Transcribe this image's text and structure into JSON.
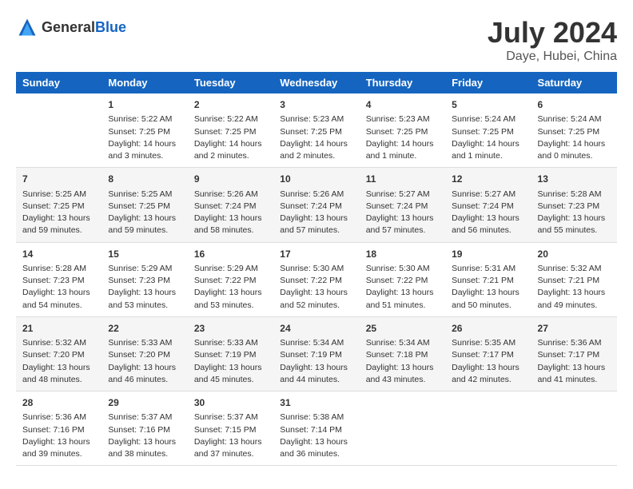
{
  "app": {
    "name_general": "General",
    "name_blue": "Blue"
  },
  "calendar": {
    "title": "July 2024",
    "location": "Daye, Hubei, China",
    "days_of_week": [
      "Sunday",
      "Monday",
      "Tuesday",
      "Wednesday",
      "Thursday",
      "Friday",
      "Saturday"
    ],
    "weeks": [
      [
        {
          "day": "",
          "details": ""
        },
        {
          "day": "1",
          "details": "Sunrise: 5:22 AM\nSunset: 7:25 PM\nDaylight: 14 hours\nand 3 minutes."
        },
        {
          "day": "2",
          "details": "Sunrise: 5:22 AM\nSunset: 7:25 PM\nDaylight: 14 hours\nand 2 minutes."
        },
        {
          "day": "3",
          "details": "Sunrise: 5:23 AM\nSunset: 7:25 PM\nDaylight: 14 hours\nand 2 minutes."
        },
        {
          "day": "4",
          "details": "Sunrise: 5:23 AM\nSunset: 7:25 PM\nDaylight: 14 hours\nand 1 minute."
        },
        {
          "day": "5",
          "details": "Sunrise: 5:24 AM\nSunset: 7:25 PM\nDaylight: 14 hours\nand 1 minute."
        },
        {
          "day": "6",
          "details": "Sunrise: 5:24 AM\nSunset: 7:25 PM\nDaylight: 14 hours\nand 0 minutes."
        }
      ],
      [
        {
          "day": "7",
          "details": "Sunrise: 5:25 AM\nSunset: 7:25 PM\nDaylight: 13 hours\nand 59 minutes."
        },
        {
          "day": "8",
          "details": "Sunrise: 5:25 AM\nSunset: 7:25 PM\nDaylight: 13 hours\nand 59 minutes."
        },
        {
          "day": "9",
          "details": "Sunrise: 5:26 AM\nSunset: 7:24 PM\nDaylight: 13 hours\nand 58 minutes."
        },
        {
          "day": "10",
          "details": "Sunrise: 5:26 AM\nSunset: 7:24 PM\nDaylight: 13 hours\nand 57 minutes."
        },
        {
          "day": "11",
          "details": "Sunrise: 5:27 AM\nSunset: 7:24 PM\nDaylight: 13 hours\nand 57 minutes."
        },
        {
          "day": "12",
          "details": "Sunrise: 5:27 AM\nSunset: 7:24 PM\nDaylight: 13 hours\nand 56 minutes."
        },
        {
          "day": "13",
          "details": "Sunrise: 5:28 AM\nSunset: 7:23 PM\nDaylight: 13 hours\nand 55 minutes."
        }
      ],
      [
        {
          "day": "14",
          "details": "Sunrise: 5:28 AM\nSunset: 7:23 PM\nDaylight: 13 hours\nand 54 minutes."
        },
        {
          "day": "15",
          "details": "Sunrise: 5:29 AM\nSunset: 7:23 PM\nDaylight: 13 hours\nand 53 minutes."
        },
        {
          "day": "16",
          "details": "Sunrise: 5:29 AM\nSunset: 7:22 PM\nDaylight: 13 hours\nand 53 minutes."
        },
        {
          "day": "17",
          "details": "Sunrise: 5:30 AM\nSunset: 7:22 PM\nDaylight: 13 hours\nand 52 minutes."
        },
        {
          "day": "18",
          "details": "Sunrise: 5:30 AM\nSunset: 7:22 PM\nDaylight: 13 hours\nand 51 minutes."
        },
        {
          "day": "19",
          "details": "Sunrise: 5:31 AM\nSunset: 7:21 PM\nDaylight: 13 hours\nand 50 minutes."
        },
        {
          "day": "20",
          "details": "Sunrise: 5:32 AM\nSunset: 7:21 PM\nDaylight: 13 hours\nand 49 minutes."
        }
      ],
      [
        {
          "day": "21",
          "details": "Sunrise: 5:32 AM\nSunset: 7:20 PM\nDaylight: 13 hours\nand 48 minutes."
        },
        {
          "day": "22",
          "details": "Sunrise: 5:33 AM\nSunset: 7:20 PM\nDaylight: 13 hours\nand 46 minutes."
        },
        {
          "day": "23",
          "details": "Sunrise: 5:33 AM\nSunset: 7:19 PM\nDaylight: 13 hours\nand 45 minutes."
        },
        {
          "day": "24",
          "details": "Sunrise: 5:34 AM\nSunset: 7:19 PM\nDaylight: 13 hours\nand 44 minutes."
        },
        {
          "day": "25",
          "details": "Sunrise: 5:34 AM\nSunset: 7:18 PM\nDaylight: 13 hours\nand 43 minutes."
        },
        {
          "day": "26",
          "details": "Sunrise: 5:35 AM\nSunset: 7:17 PM\nDaylight: 13 hours\nand 42 minutes."
        },
        {
          "day": "27",
          "details": "Sunrise: 5:36 AM\nSunset: 7:17 PM\nDaylight: 13 hours\nand 41 minutes."
        }
      ],
      [
        {
          "day": "28",
          "details": "Sunrise: 5:36 AM\nSunset: 7:16 PM\nDaylight: 13 hours\nand 39 minutes."
        },
        {
          "day": "29",
          "details": "Sunrise: 5:37 AM\nSunset: 7:16 PM\nDaylight: 13 hours\nand 38 minutes."
        },
        {
          "day": "30",
          "details": "Sunrise: 5:37 AM\nSunset: 7:15 PM\nDaylight: 13 hours\nand 37 minutes."
        },
        {
          "day": "31",
          "details": "Sunrise: 5:38 AM\nSunset: 7:14 PM\nDaylight: 13 hours\nand 36 minutes."
        },
        {
          "day": "",
          "details": ""
        },
        {
          "day": "",
          "details": ""
        },
        {
          "day": "",
          "details": ""
        }
      ]
    ]
  }
}
